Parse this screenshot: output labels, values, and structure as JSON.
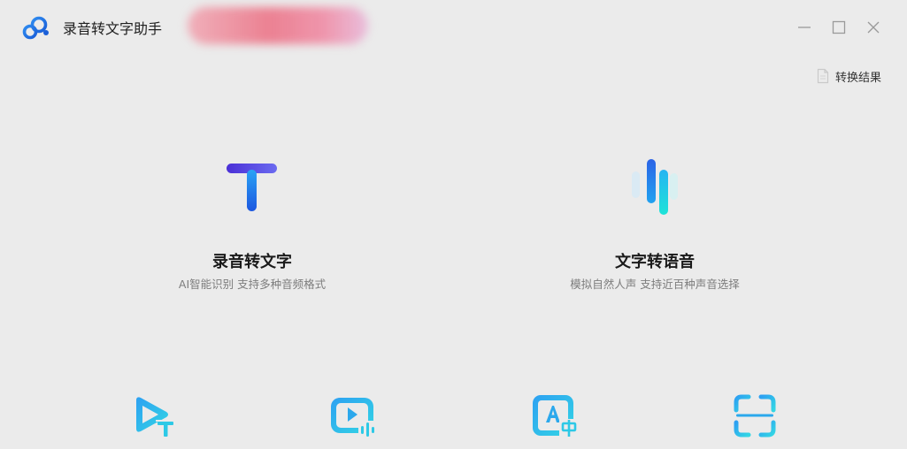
{
  "app": {
    "title": "录音转文字助手",
    "logo_icon": "cloud-logo-icon",
    "accent": "#1e6fe6"
  },
  "window_controls": [
    {
      "icon": "minimize-icon"
    },
    {
      "icon": "maximize-icon"
    },
    {
      "icon": "close-icon"
    }
  ],
  "header": {
    "result_link": {
      "icon": "document-icon",
      "label": "转换结果"
    }
  },
  "features": [
    {
      "icon": "text-t-icon",
      "title": "录音转文字",
      "subtitle": "AI智能识别 支持多种音频格式"
    },
    {
      "icon": "sound-wave-icon",
      "title": "文字转语音",
      "subtitle": "模拟自然人声 支持近百种声音选择"
    }
  ],
  "tools": [
    {
      "icon": "video-to-text-icon"
    },
    {
      "icon": "video-audio-icon"
    },
    {
      "icon": "translate-a-zh-icon"
    },
    {
      "icon": "scan-icon"
    }
  ]
}
